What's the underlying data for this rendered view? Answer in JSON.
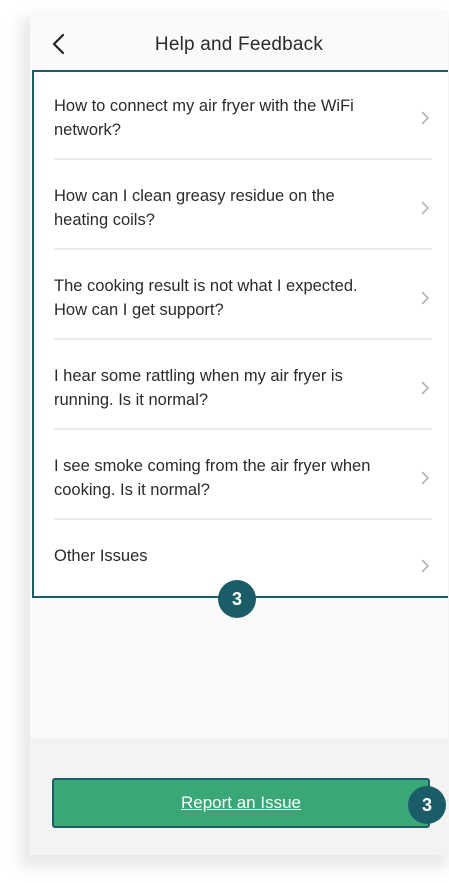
{
  "header": {
    "title": "Help and Feedback",
    "back_icon": "chevron-left-icon"
  },
  "faq": {
    "items": [
      {
        "line1": "How to connect my air fryer with the WiFi",
        "line2": "network?"
      },
      {
        "line1": "How can I clean greasy residue on the",
        "line2": "heating coils?"
      },
      {
        "line1": "The cooking result is not what I expected.",
        "line2": "How can I get support?"
      },
      {
        "line1": "I hear some rattling when my air fryer is",
        "line2": "running. Is it normal?"
      },
      {
        "line1": "I see smoke coming from the air fryer when",
        "line2": "cooking. Is it normal?"
      },
      {
        "line1": "Other Issues",
        "line2": ""
      }
    ],
    "chevron_icon": "chevron-right-icon"
  },
  "annotations": {
    "list_badge": "3",
    "button_badge": "3"
  },
  "footer": {
    "report_label": "Report an Issue"
  },
  "colors": {
    "accent_teal": "#1b5c69",
    "button_green": "#3aa776"
  }
}
